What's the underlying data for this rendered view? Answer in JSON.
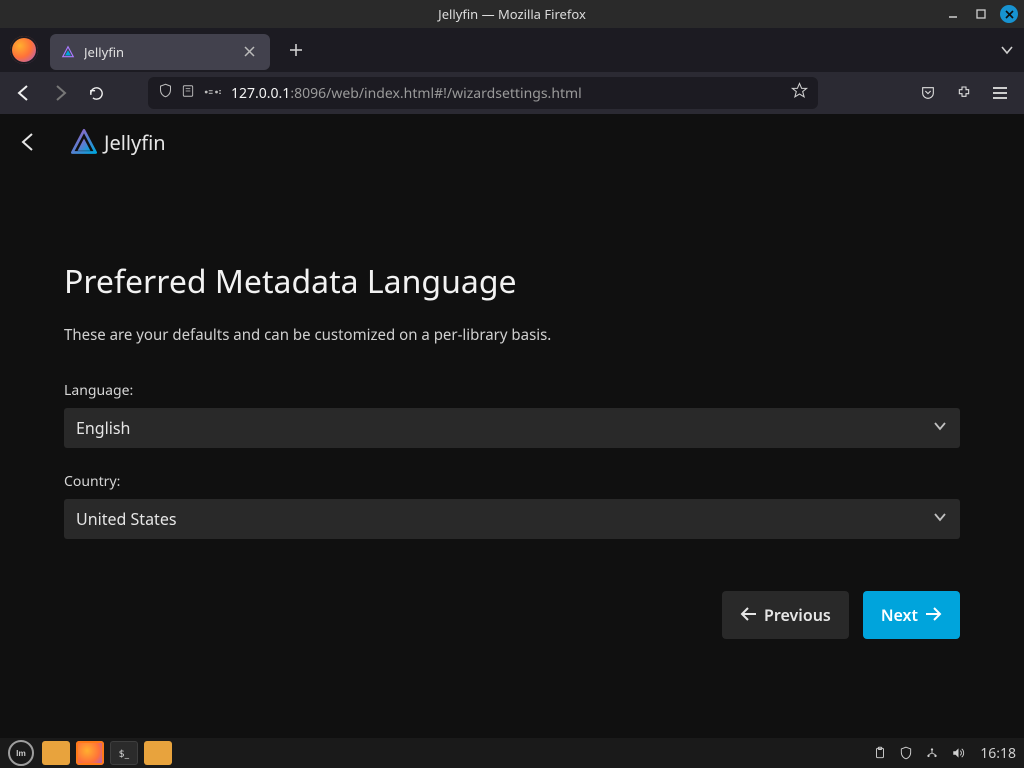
{
  "window": {
    "title": "Jellyfin — Mozilla Firefox"
  },
  "tab": {
    "title": "Jellyfin"
  },
  "url": {
    "host": "127.0.0.1",
    "port": ":8096",
    "path": "/web/index.html#!/wizardsettings.html"
  },
  "app": {
    "name": "Jellyfin"
  },
  "page": {
    "title": "Preferred Metadata Language",
    "subtitle": "These are your defaults and can be customized on a per-library basis.",
    "language_label": "Language:",
    "language_value": "English",
    "country_label": "Country:",
    "country_value": "United States",
    "previous_btn": "Previous",
    "next_btn": "Next"
  },
  "clock": {
    "time": "16:18"
  }
}
